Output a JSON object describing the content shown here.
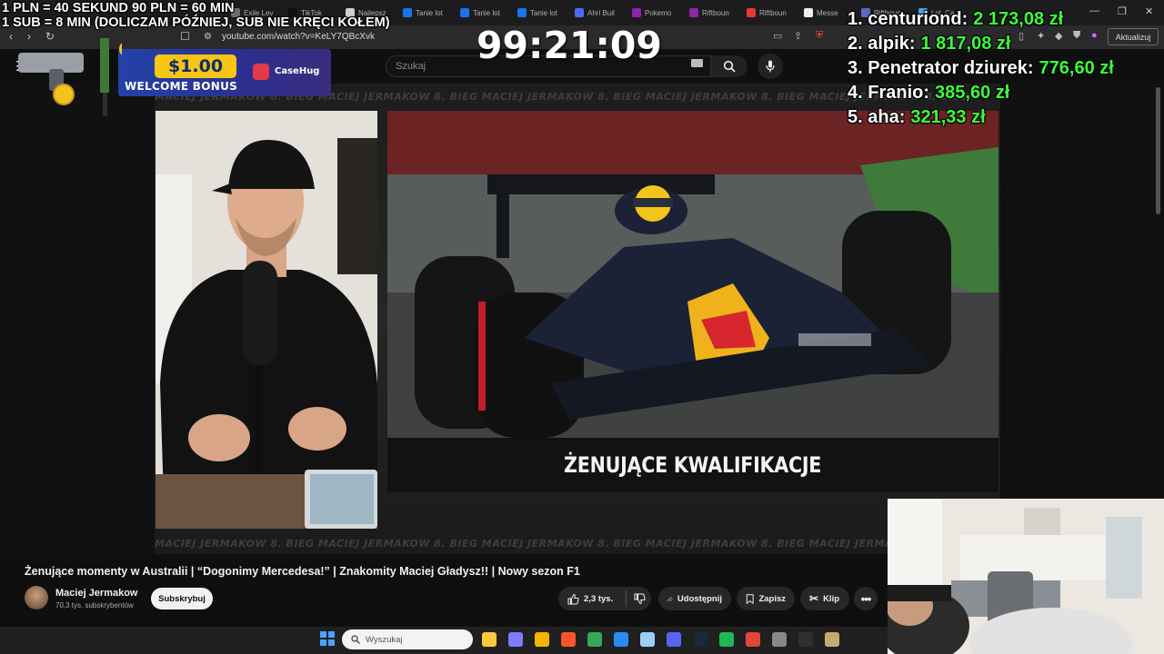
{
  "overlay": {
    "donation_line1": "1 PLN =  40 SEKUND 90 PLN = 60 MIN",
    "donation_line2": "1 SUB = 8 MIN (DOLICZAM PÓŹNIEJ, SUB NIE KRĘCI KOŁEM)",
    "timer": "99:21:09",
    "leaderboard": [
      {
        "name": "1. centuriond:",
        "amount": "2 173,08 zł"
      },
      {
        "name": "2. alpik:",
        "amount": "1 817,08 zł"
      },
      {
        "name": "3. Penetrator dziurek:",
        "amount": "776,60 zł"
      },
      {
        "name": "4. Franio:",
        "amount": "385,60 zł"
      },
      {
        "name": "5. aha:",
        "amount": "321,33 zł"
      }
    ],
    "leaderboard_name_color": "#ffffff",
    "leaderboard_amount_color": "#3bff3b",
    "promo": {
      "amount": "$1.00",
      "bonus": "WELCOME BONUS",
      "brand": "CaseHug"
    }
  },
  "browser": {
    "tabs": [
      {
        "label": "Exile Lev",
        "color": "#6b6b6b"
      },
      {
        "label": "TikTok",
        "color": "#111111"
      },
      {
        "label": "Najlepsz",
        "color": "#d0d0d0"
      },
      {
        "label": "Tanie lot",
        "color": "#1a73e8"
      },
      {
        "label": "Tanie lot",
        "color": "#1a73e8"
      },
      {
        "label": "Tanie lot",
        "color": "#1a73e8"
      },
      {
        "label": "Ahri Buil",
        "color": "#4a6cf7"
      },
      {
        "label": "Pokemo",
        "color": "#8e24aa"
      },
      {
        "label": "Riftboun",
        "color": "#8e24aa"
      },
      {
        "label": "Riftboun",
        "color": "#e53935"
      },
      {
        "label": "Messe",
        "color": "#eeeeee"
      },
      {
        "label": "Riftboun",
        "color": "#5c6bc0"
      },
      {
        "label": "LoL Ca",
        "color": "#42a5f5"
      }
    ],
    "url": "youtube.com/watch?v=KeLY7QBcXvk",
    "update_label": "Aktualizuj"
  },
  "youtube": {
    "search_placeholder": "Szukaj",
    "video_band_text": "MACIEJ JERMAKOW 8. BIEG MACIEJ JERMAKOW 8. BIEG MACIEJ JERMAKOW 8. BIEG MACIEJ JERMAKOW 8. BIEG MACIEJ JERMAKOW 8. BIEG",
    "video_caption": "ŻENUJĄCE KWALIFIKACJE",
    "title": "Żenujące momenty w Australii | “Dogonimy Mercedesa!” | Znakomity Maciej Gładysz!! | Nowy sezon F1",
    "channel_name": "Maciej Jermakow",
    "channel_subs": "70,3 tys. subskrybentów",
    "subscribe_label": "Subskrybuj",
    "like_count": "2,3 tys.",
    "share_label": "Udostępnij",
    "save_label": "Zapisz",
    "clip_label": "Klip"
  },
  "taskbar": {
    "search_placeholder": "Wyszukaj",
    "apps": [
      {
        "name": "file-explorer-icon",
        "color": "#ffc83d"
      },
      {
        "name": "copilot-icon",
        "color": "#7f7bff"
      },
      {
        "name": "folder-icon",
        "color": "#f5b400"
      },
      {
        "name": "brave-icon",
        "color": "#fb542b"
      },
      {
        "name": "chrome-icon",
        "color": "#34a853"
      },
      {
        "name": "store-icon",
        "color": "#2a8af6"
      },
      {
        "name": "notepad-icon",
        "color": "#9ad0f5"
      },
      {
        "name": "discord-icon",
        "color": "#5865f2"
      },
      {
        "name": "steam-icon",
        "color": "#1b2838"
      },
      {
        "name": "spotify-icon",
        "color": "#1db954"
      },
      {
        "name": "brave-nightly-icon",
        "color": "#e0473a"
      },
      {
        "name": "settings-icon",
        "color": "#888888"
      },
      {
        "name": "obs-icon",
        "color": "#302e31"
      },
      {
        "name": "league-icon",
        "color": "#c8aa6e"
      }
    ]
  }
}
